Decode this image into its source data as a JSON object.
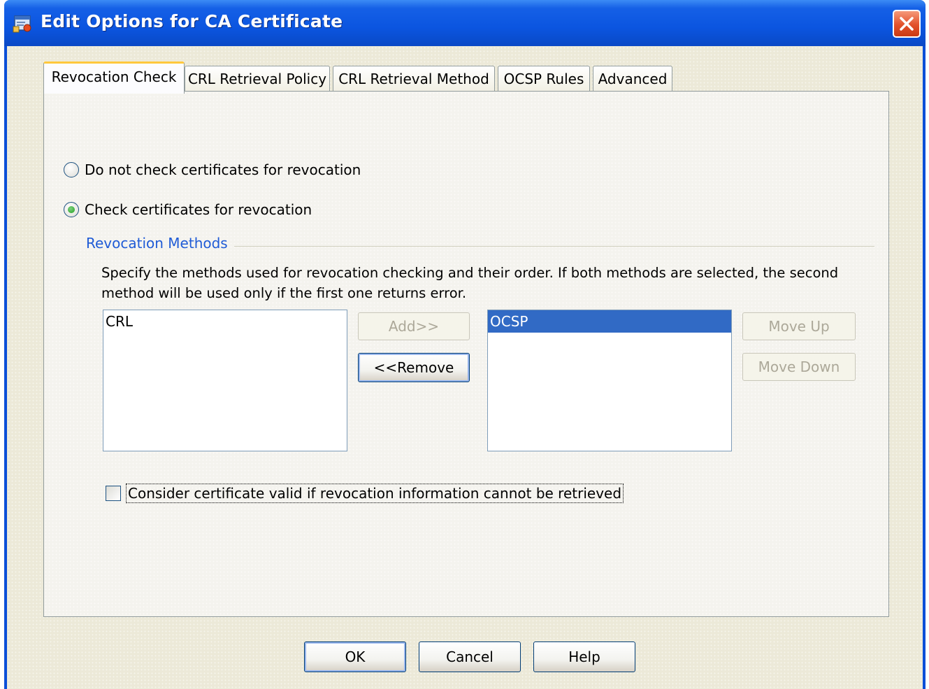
{
  "window": {
    "title": "Edit Options for CA Certificate",
    "close_label": "Close"
  },
  "tabs": [
    {
      "label": "Revocation Check",
      "active": true
    },
    {
      "label": "CRL Retrieval Policy",
      "active": false
    },
    {
      "label": "CRL Retrieval Method",
      "active": false
    },
    {
      "label": "OCSP Rules",
      "active": false
    },
    {
      "label": "Advanced",
      "active": false
    }
  ],
  "revocation": {
    "option_no_check": "Do not check certificates for revocation",
    "option_check": "Check certificates for revocation",
    "selected_option": "check"
  },
  "methods": {
    "group_title": "Revocation Methods",
    "description": "Specify the methods used for revocation checking and their order. If both methods are selected, the second method will be used only if the first one returns error.",
    "available": [
      "CRL"
    ],
    "selected": [
      "OCSP"
    ],
    "selected_highlight": "OCSP",
    "add_label": "Add>>",
    "remove_label": "<<Remove",
    "move_up_label": "Move Up",
    "move_down_label": "Move Down"
  },
  "consider_valid": {
    "label": "Consider certificate valid if revocation information cannot be retrieved",
    "checked": false
  },
  "buttons": {
    "ok": "OK",
    "cancel": "Cancel",
    "help": "Help"
  },
  "colors": {
    "titlebar": "#0b55e0",
    "dialog_bg": "#ece9d8",
    "group_title": "#1f5bd6",
    "selection": "#316ac5",
    "active_tab_accent": "#ffc83c"
  }
}
